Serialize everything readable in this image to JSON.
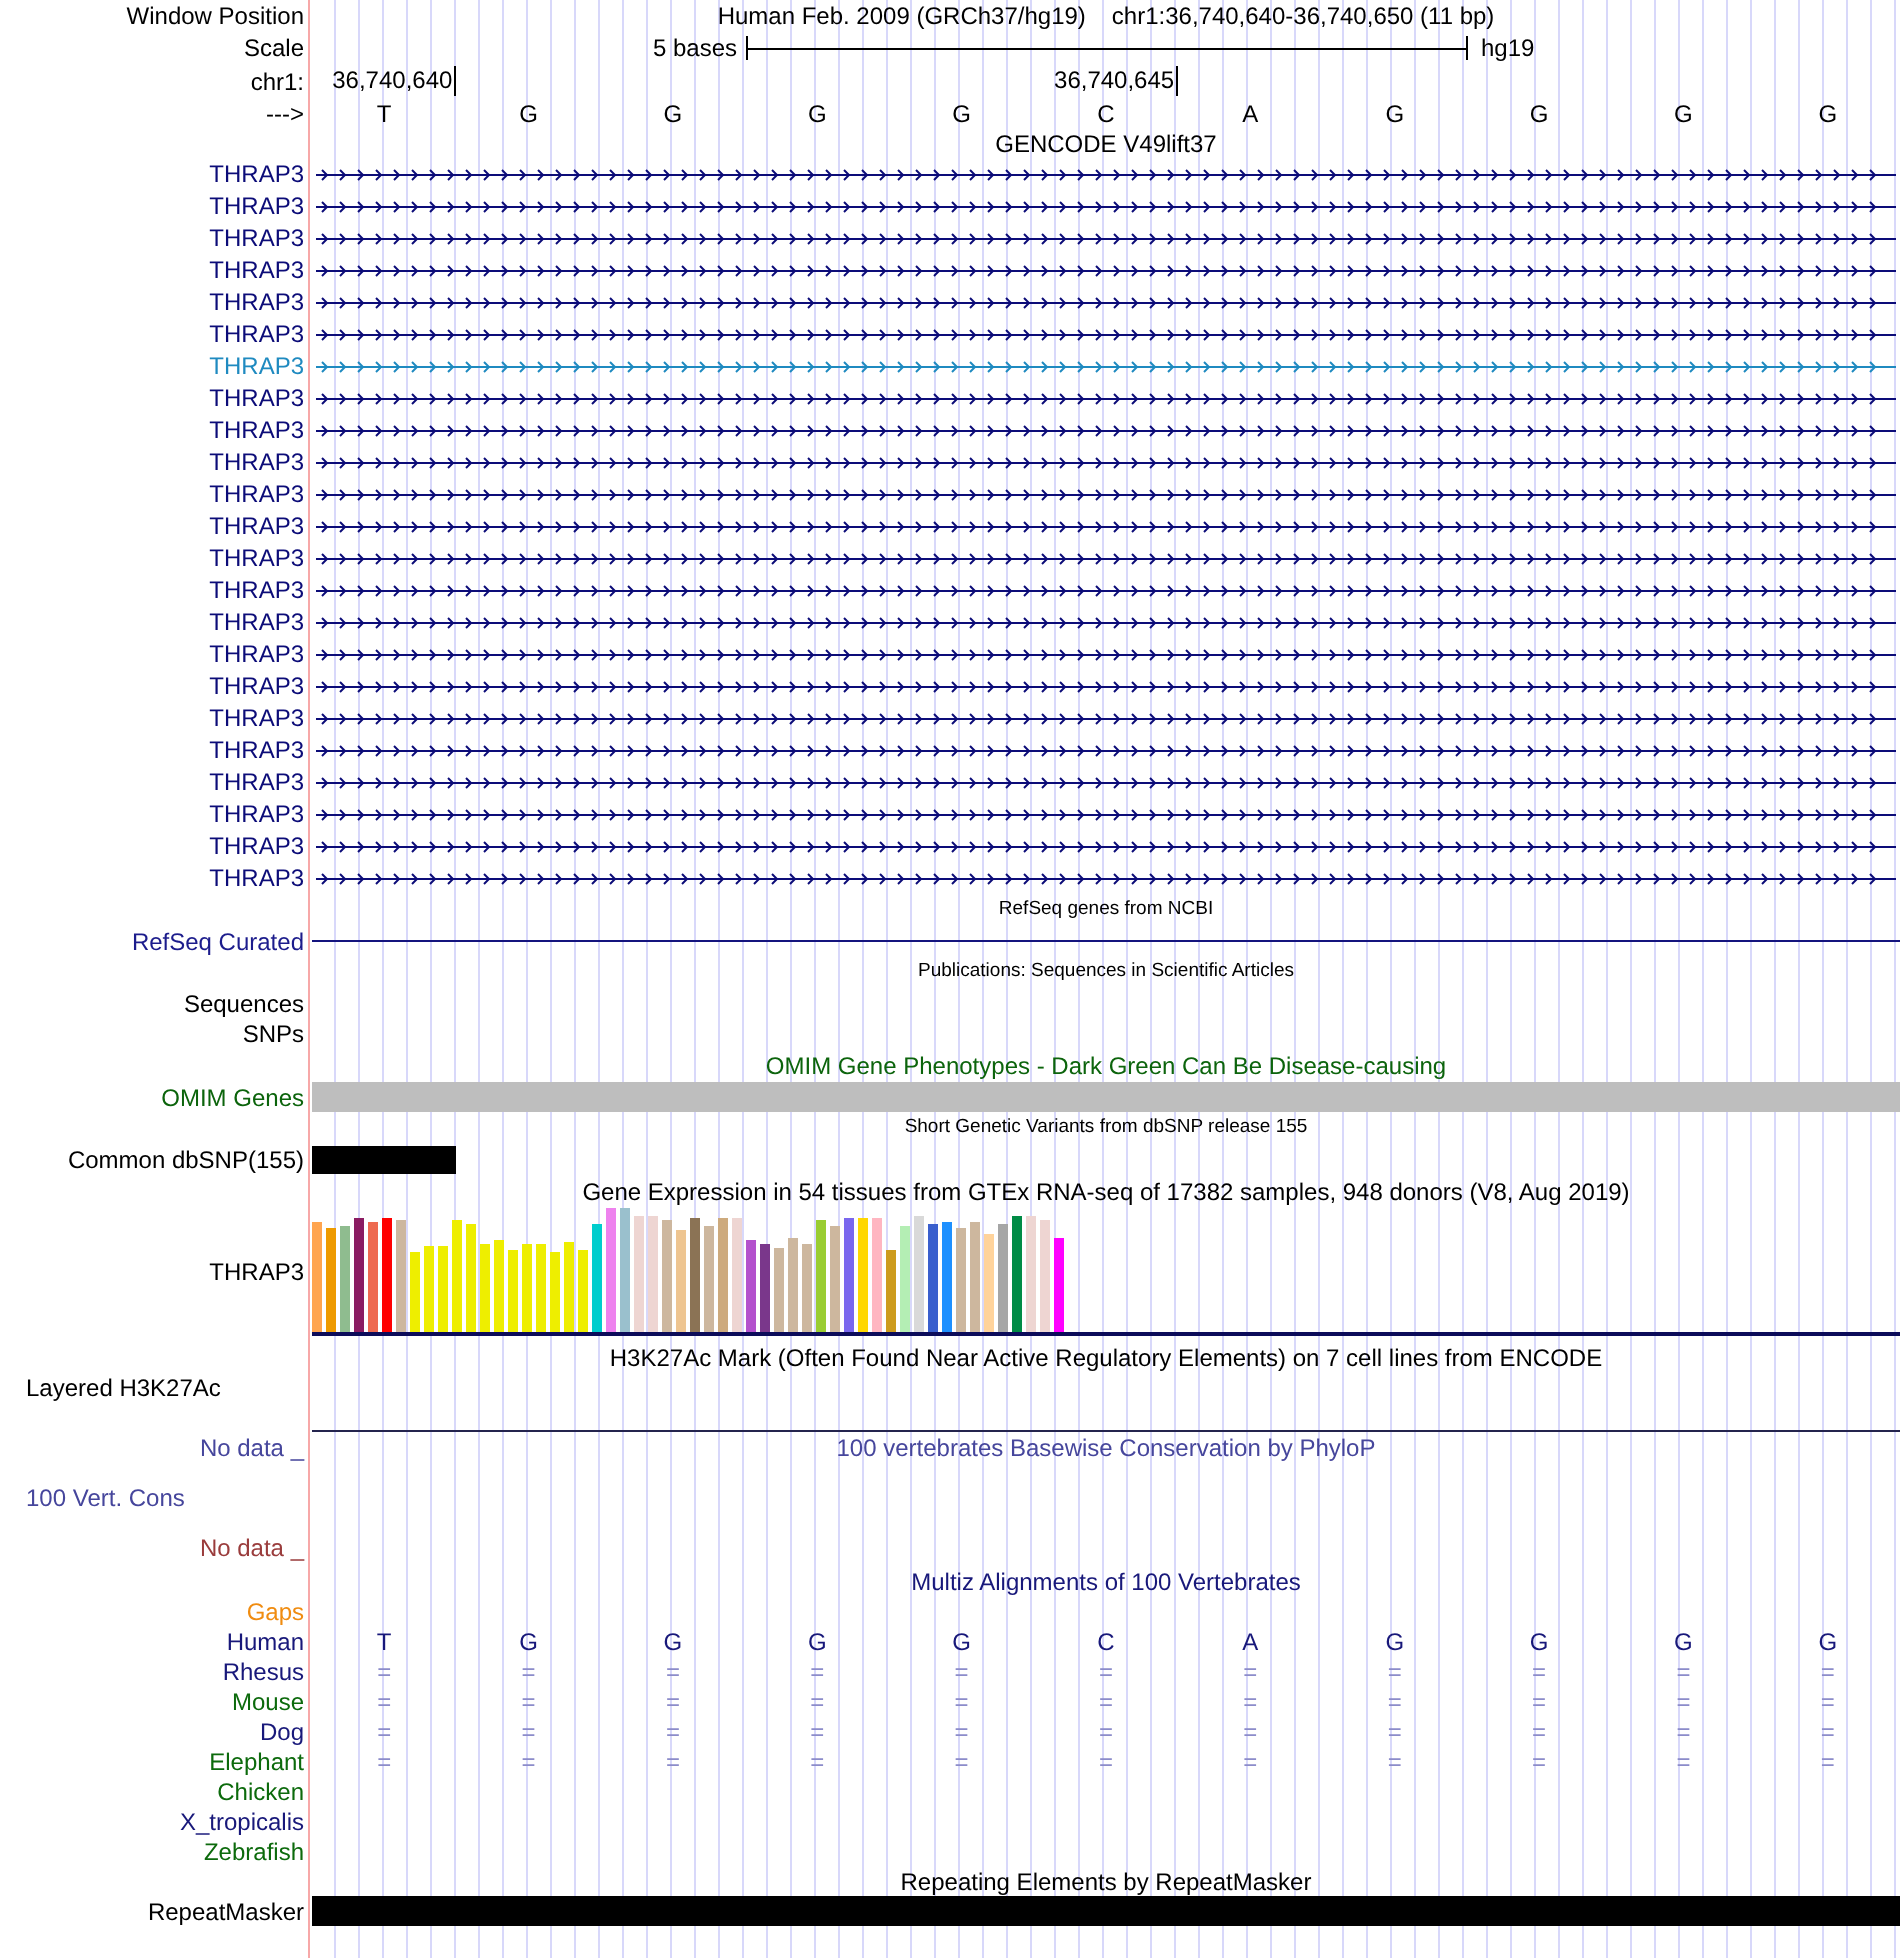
{
  "position_header": {
    "label": "Window Position",
    "assembly": "Human Feb. 2009 (GRCh37/hg19)",
    "range": "chr1:36,740,640-36,740,650 (11 bp)"
  },
  "scale": {
    "label": "Scale",
    "bar_text": "5 bases",
    "assembly": "hg19"
  },
  "coordinates": {
    "label": "chr1:",
    "ticks": [
      "36,740,640",
      "36,740,645"
    ]
  },
  "sequence": {
    "label": "--->",
    "bases": [
      "T",
      "G",
      "G",
      "G",
      "G",
      "C",
      "A",
      "G",
      "G",
      "G",
      "G"
    ]
  },
  "tracks": [
    {
      "kind": "genes",
      "title": "GENCODE V49lift37",
      "items": [
        {
          "name": "THRAP3",
          "color": "#0c0c78"
        },
        {
          "name": "THRAP3",
          "color": "#0c0c78"
        },
        {
          "name": "THRAP3",
          "color": "#0c0c78"
        },
        {
          "name": "THRAP3",
          "color": "#0c0c78"
        },
        {
          "name": "THRAP3",
          "color": "#0c0c78"
        },
        {
          "name": "THRAP3",
          "color": "#0c0c78"
        },
        {
          "name": "THRAP3",
          "color": "#1f8ac0"
        },
        {
          "name": "THRAP3",
          "color": "#0c0c78"
        },
        {
          "name": "THRAP3",
          "color": "#0c0c78"
        },
        {
          "name": "THRAP3",
          "color": "#0c0c78"
        },
        {
          "name": "THRAP3",
          "color": "#0c0c78"
        },
        {
          "name": "THRAP3",
          "color": "#0c0c78"
        },
        {
          "name": "THRAP3",
          "color": "#0c0c78"
        },
        {
          "name": "THRAP3",
          "color": "#0c0c78"
        },
        {
          "name": "THRAP3",
          "color": "#0c0c78"
        },
        {
          "name": "THRAP3",
          "color": "#0c0c78"
        },
        {
          "name": "THRAP3",
          "color": "#0c0c78"
        },
        {
          "name": "THRAP3",
          "color": "#0c0c78"
        },
        {
          "name": "THRAP3",
          "color": "#0c0c78"
        },
        {
          "name": "THRAP3",
          "color": "#0c0c78"
        },
        {
          "name": "THRAP3",
          "color": "#0c0c78"
        },
        {
          "name": "THRAP3",
          "color": "#0c0c78"
        },
        {
          "name": "THRAP3",
          "color": "#0c0c78"
        }
      ]
    },
    {
      "kind": "refseq",
      "title": "RefSeq genes from NCBI",
      "label": "RefSeq Curated"
    },
    {
      "kind": "publications",
      "title": "Publications: Sequences in Scientific Articles",
      "labels": [
        "Sequences",
        "SNPs"
      ]
    },
    {
      "kind": "omim",
      "title": "OMIM Gene Phenotypes - Dark Green Can Be Disease-causing",
      "label": "OMIM Genes"
    },
    {
      "kind": "dbsnp",
      "title": "Short Genetic Variants from dbSNP release 155",
      "label": "Common dbSNP(155)"
    },
    {
      "kind": "gtex",
      "title": "Gene Expression in 54 tissues from GTEx RNA-seq of 17382 samples, 948 donors (V8, Aug 2019)",
      "label": "THRAP3"
    },
    {
      "kind": "h3k27ac",
      "title": "H3K27Ac Mark (Often Found Near Active Regulatory Elements) on 7 cell lines from ENCODE",
      "label": "Layered H3K27Ac"
    },
    {
      "kind": "conservation",
      "title": "100 vertebrates Basewise Conservation by PhyloP",
      "label": "100 Vert. Cons",
      "subtracks": [
        {
          "no_data": "No data _",
          "color": "#46469c"
        },
        {
          "no_data": "No data _",
          "color": "#9a3c3c"
        }
      ]
    },
    {
      "kind": "multiz",
      "title": "Multiz Alignments of 100 Vertebrates",
      "gaps_label": "Gaps",
      "species": [
        {
          "name": "Human",
          "color": "#18187a",
          "kind": "reference",
          "bases": [
            "T",
            "G",
            "G",
            "G",
            "G",
            "C",
            "A",
            "G",
            "G",
            "G",
            "G"
          ]
        },
        {
          "name": "Rhesus",
          "color": "#18187a",
          "kind": "match",
          "bases": [
            "=",
            "=",
            "=",
            "=",
            "=",
            "=",
            "=",
            "=",
            "=",
            "=",
            "="
          ]
        },
        {
          "name": "Mouse",
          "color": "#0c6a0c",
          "kind": "match",
          "bases": [
            "=",
            "=",
            "=",
            "=",
            "=",
            "=",
            "=",
            "=",
            "=",
            "=",
            "="
          ]
        },
        {
          "name": "Dog",
          "color": "#18187a",
          "kind": "match",
          "bases": [
            "=",
            "=",
            "=",
            "=",
            "=",
            "=",
            "=",
            "=",
            "=",
            "=",
            "="
          ]
        },
        {
          "name": "Elephant",
          "color": "#0c6a0c",
          "kind": "match",
          "bases": [
            "=",
            "=",
            "=",
            "=",
            "=",
            "=",
            "=",
            "=",
            "=",
            "=",
            "="
          ]
        },
        {
          "name": "Chicken",
          "color": "#0c6a0c"
        },
        {
          "name": "X_tropicalis",
          "color": "#18187a"
        },
        {
          "name": "Zebrafish",
          "color": "#0c6a0c"
        }
      ]
    },
    {
      "kind": "repeatmasker",
      "title": "Repeating Elements by RepeatMasker",
      "label": "RepeatMasker"
    }
  ]
}
